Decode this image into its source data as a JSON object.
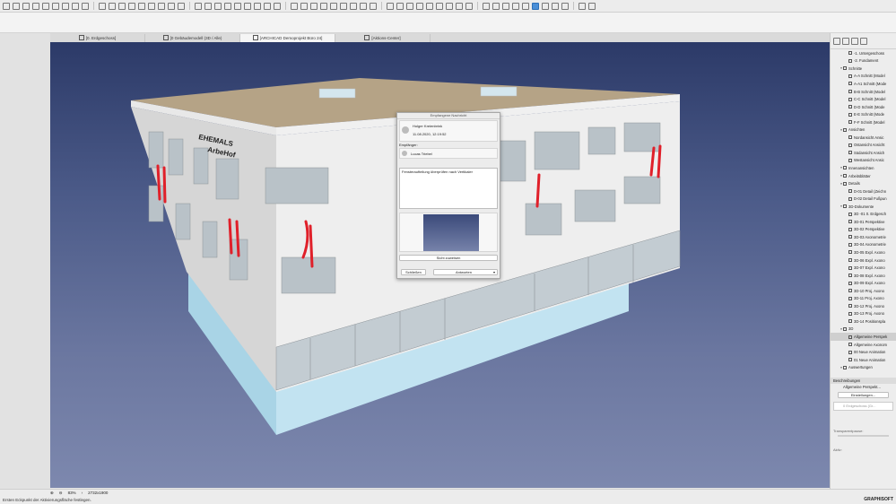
{
  "tabs": [
    {
      "label": "[0. Erdgeschoss]",
      "active": false
    },
    {
      "label": "[0 Gebäudemodell (3D / Alle)",
      "active": false
    },
    {
      "label": "[ARCHICAD Demoprojekt Büro 24]",
      "active": true
    },
    {
      "label": "[Aktions-Center]",
      "active": false
    }
  ],
  "navigator": {
    "items": [
      {
        "label": "-1. Untergeschoss",
        "depth": 2,
        "selected": false
      },
      {
        "label": "-2. Fundament",
        "depth": 2,
        "selected": false
      },
      {
        "label": "Schnitte",
        "depth": 1,
        "selected": false
      },
      {
        "label": "A-A Schnitt (Model",
        "depth": 2,
        "selected": false
      },
      {
        "label": "A-A1 Schnitt (Mode",
        "depth": 2,
        "selected": false
      },
      {
        "label": "B-B Schnitt (Model",
        "depth": 2,
        "selected": false
      },
      {
        "label": "C-C Schnitt (Model",
        "depth": 2,
        "selected": false
      },
      {
        "label": "D-D Schnitt (Mode",
        "depth": 2,
        "selected": false
      },
      {
        "label": "E-E Schnitt (Mode",
        "depth": 2,
        "selected": false
      },
      {
        "label": "F-F Schnitt (Model",
        "depth": 2,
        "selected": false
      },
      {
        "label": "Ansichten",
        "depth": 1,
        "selected": false
      },
      {
        "label": "Nordansicht Ansic",
        "depth": 2,
        "selected": false
      },
      {
        "label": "Ostansicht Ansicht",
        "depth": 2,
        "selected": false
      },
      {
        "label": "Südansicht Ansich",
        "depth": 2,
        "selected": false
      },
      {
        "label": "Westansicht Ansic",
        "depth": 2,
        "selected": false
      },
      {
        "label": "Innenansichten",
        "depth": 1,
        "selected": false
      },
      {
        "label": "Arbeitsblätter",
        "depth": 1,
        "selected": false
      },
      {
        "label": "Details",
        "depth": 1,
        "selected": false
      },
      {
        "label": "D-01 Detail (Zeichn",
        "depth": 2,
        "selected": false
      },
      {
        "label": "D-02 Detail Fußpun",
        "depth": 2,
        "selected": false
      },
      {
        "label": "3D-Dokumente",
        "depth": 1,
        "selected": false
      },
      {
        "label": "3D -01 0. Erdgesch",
        "depth": 2,
        "selected": false
      },
      {
        "label": "3D-01 Perspektive",
        "depth": 2,
        "selected": false
      },
      {
        "label": "3D-02 Perspektive",
        "depth": 2,
        "selected": false
      },
      {
        "label": "3D-03 Axonometrie",
        "depth": 2,
        "selected": false
      },
      {
        "label": "3D-04 Axonometrie",
        "depth": 2,
        "selected": false
      },
      {
        "label": "3D-05 Expl. Axono",
        "depth": 2,
        "selected": false
      },
      {
        "label": "3D-06 Expl. Axono",
        "depth": 2,
        "selected": false
      },
      {
        "label": "3D-07 Expl. Axono",
        "depth": 2,
        "selected": false
      },
      {
        "label": "3D-08 Expl. Axono",
        "depth": 2,
        "selected": false
      },
      {
        "label": "3D-09 Expl. Axono",
        "depth": 2,
        "selected": false
      },
      {
        "label": "3D-10 Proj. Axono",
        "depth": 2,
        "selected": false
      },
      {
        "label": "3D-11 Proj. Axono",
        "depth": 2,
        "selected": false
      },
      {
        "label": "3D-12 Proj. Axono",
        "depth": 2,
        "selected": false
      },
      {
        "label": "3D-13 Proj. Axono",
        "depth": 2,
        "selected": false
      },
      {
        "label": "3D-14 Positionspla",
        "depth": 2,
        "selected": false
      },
      {
        "label": "3D",
        "depth": 1,
        "selected": false
      },
      {
        "label": "Allgemeine Perspek",
        "depth": 2,
        "selected": true
      },
      {
        "label": "Allgemeine Axonom",
        "depth": 2,
        "selected": false
      },
      {
        "label": "00 Neue Animation",
        "depth": 2,
        "selected": false
      },
      {
        "label": "01 Neue Animation",
        "depth": 2,
        "selected": false
      },
      {
        "label": "Auswertungen",
        "depth": 1,
        "selected": false
      }
    ]
  },
  "properties": {
    "header": "Beschreibungen",
    "view_name": "Allgemeine Perspekt...",
    "settings_button": "Einstellungen...",
    "layer_combo": "0 Erdgeschoss (Gr...",
    "transparency_label": "Transparentpause:",
    "active_label": "Aktiv:"
  },
  "message_dialog": {
    "title": "Empfangene Nachricht",
    "sender": "Holger Kreienbrink",
    "date": "11.08.2020, 12:19:52",
    "recipient_label": "Empfänger:",
    "recipient": "Lucas Triebel",
    "message": "Fensteraufteilung überprüfen nach Vertikaler",
    "assign_view_button": "Sicht zuweisen",
    "close_button": "Schließen",
    "reply_button": "Antworten"
  },
  "statusbar": {
    "zoom": "83%",
    "size": "2732x1900",
    "hint": "Ersten Eckpunkt der Aktivierungsfläche festlegen.",
    "brand": "GRAPHISOFT"
  },
  "building": {
    "sign_line1": "EHEMALS",
    "sign_line2": "ArbeHof"
  },
  "colors": {
    "accent": "#4a8fd8",
    "annotation": "#e0202a"
  }
}
